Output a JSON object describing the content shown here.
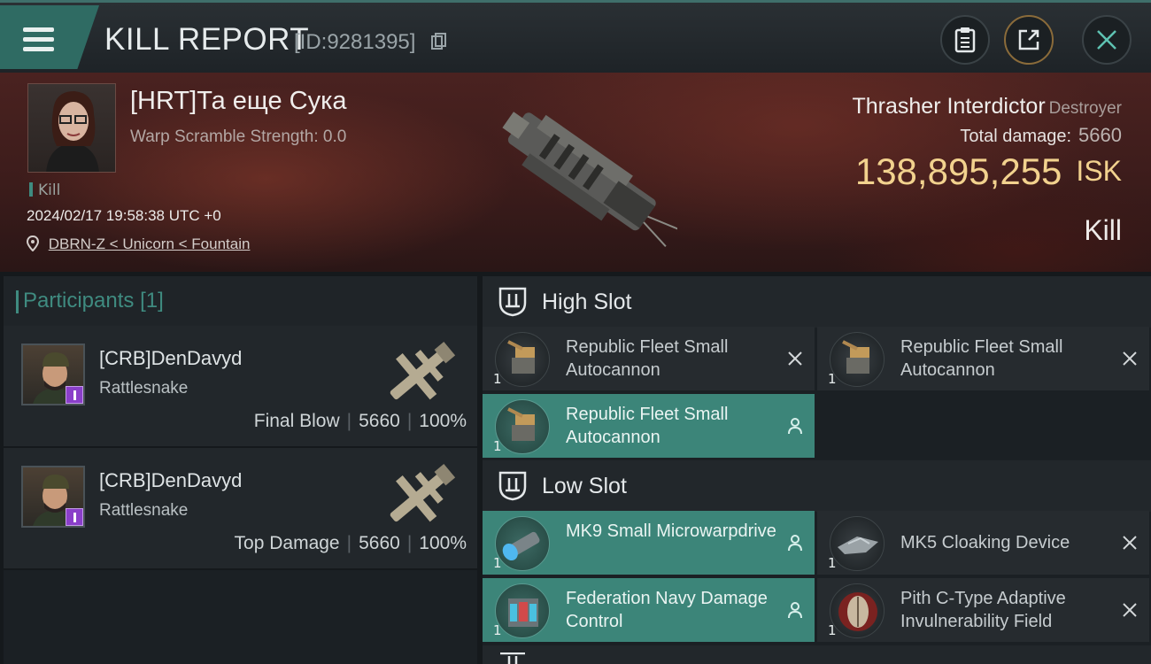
{
  "header": {
    "title": "KILL REPORT",
    "report_id": "[ID:9281395]",
    "buttons": [
      {
        "name": "clipboard",
        "icon": "clipboard-icon"
      },
      {
        "name": "share",
        "icon": "share-icon"
      },
      {
        "name": "close",
        "icon": "close-icon"
      }
    ]
  },
  "victim": {
    "name": "[HRT]Та еще Сука",
    "scramble": "Warp Scramble Strength: 0.0",
    "tag": "Kill",
    "datetime": "2024/02/17 19:58:38 UTC +0",
    "location": "DBRN-Z < Unicorn < Fountain",
    "ship_name": "Thrasher Interdictor",
    "ship_class": "Destroyer",
    "total_damage_label": "Total damage:",
    "total_damage": "5660",
    "isk_value": "138,895,255",
    "isk_unit": "ISK",
    "result": "Kill"
  },
  "participants": {
    "label": "Participants",
    "count": "[1]",
    "list": [
      {
        "name": "[CRB]DenDavyd",
        "ship": "Rattlesnake",
        "role": "Final Blow",
        "damage": "5660",
        "percent": "100%"
      },
      {
        "name": "[CRB]DenDavyd",
        "ship": "Rattlesnake",
        "role": "Top Damage",
        "damage": "5660",
        "percent": "100%"
      }
    ]
  },
  "slots": {
    "high": {
      "label": "High Slot",
      "modules": [
        {
          "name": "Republic Fleet Small Autocannon",
          "qty": "1",
          "status": "destroyed"
        },
        {
          "name": "Republic Fleet Small Autocannon",
          "qty": "1",
          "status": "destroyed"
        },
        {
          "name": "Republic Fleet Small Autocannon",
          "qty": "1",
          "status": "dropped"
        }
      ]
    },
    "low": {
      "label": "Low Slot",
      "modules": [
        {
          "name": "MK9 Small Microwarpdrive",
          "qty": "1",
          "status": "dropped"
        },
        {
          "name": "MK5 Cloaking Device",
          "qty": "1",
          "status": "destroyed"
        },
        {
          "name": "Federation Navy Damage Control",
          "qty": "1",
          "status": "dropped"
        },
        {
          "name": "Pith C-Type Adaptive Invulnerability Field",
          "qty": "1",
          "status": "destroyed"
        }
      ]
    }
  },
  "colors": {
    "accent": "#3f8b80",
    "isk": "#f2d28e",
    "dropped_bg": "#3c8579"
  }
}
